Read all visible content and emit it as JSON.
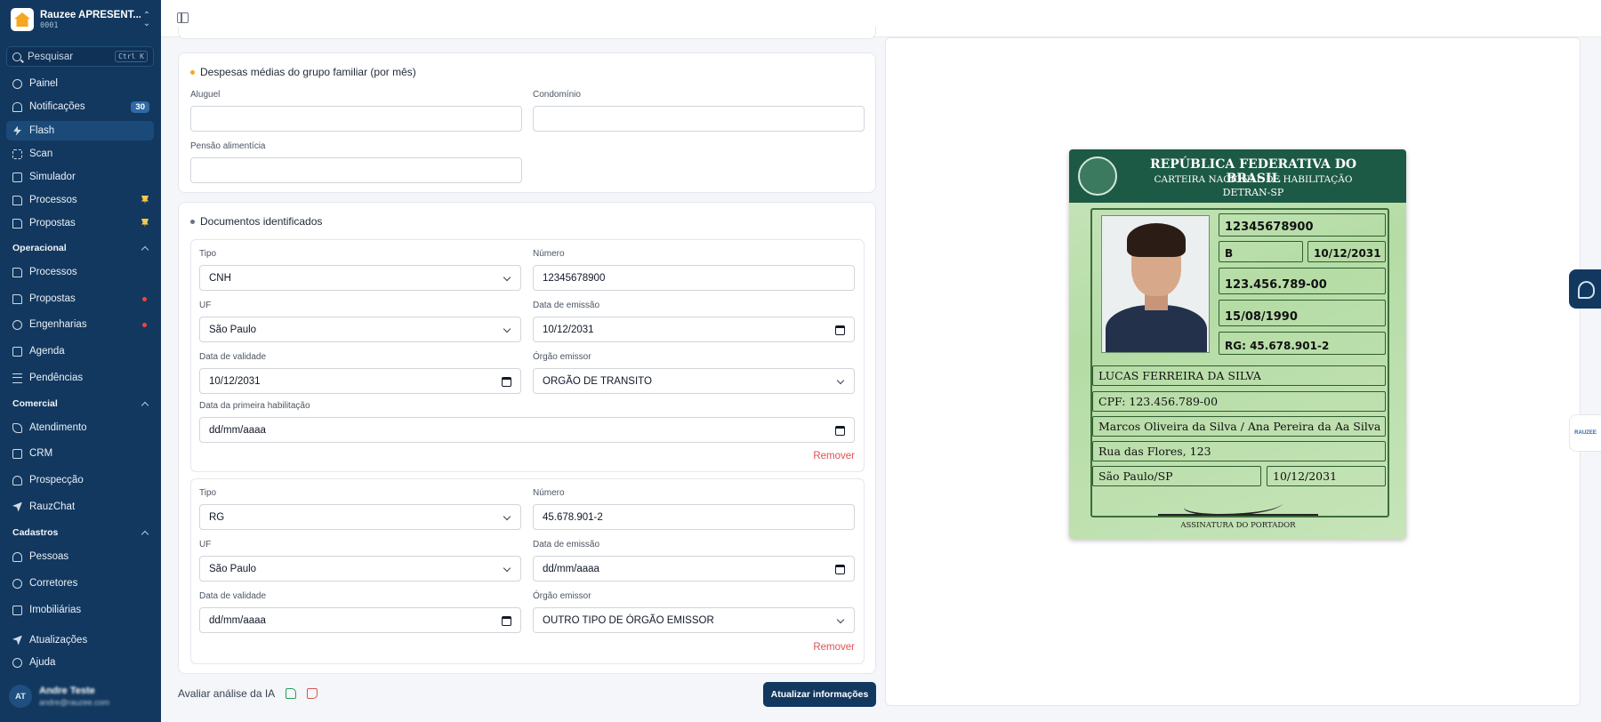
{
  "sidebar": {
    "org_name": "Rauzee APRESENT...",
    "org_code": "0001",
    "search_placeholder": "Pesquisar",
    "search_shortcut": "Ctrl K",
    "main_items": [
      {
        "label": "Painel",
        "icon": "gauge-icon"
      },
      {
        "label": "Notificações",
        "icon": "bell-icon",
        "badge": "30"
      },
      {
        "label": "Flash",
        "icon": "bolt-icon",
        "active": true
      },
      {
        "label": "Scan",
        "icon": "scan-icon"
      },
      {
        "label": "Simulador",
        "icon": "calculator-icon"
      },
      {
        "label": "Processos",
        "icon": "document-icon",
        "pinned": true
      },
      {
        "label": "Propostas",
        "icon": "document-icon",
        "pinned": true
      }
    ],
    "sections": [
      {
        "label": "Operacional",
        "items": [
          {
            "label": "Processos",
            "icon": "document-icon"
          },
          {
            "label": "Propostas",
            "icon": "document-icon",
            "dot": true
          },
          {
            "label": "Engenharias",
            "icon": "search-icon",
            "dot": true
          },
          {
            "label": "Agenda",
            "icon": "calendar-icon"
          },
          {
            "label": "Pendências",
            "icon": "list-check-icon"
          }
        ]
      },
      {
        "label": "Comercial",
        "items": [
          {
            "label": "Atendimento",
            "icon": "phone-icon"
          },
          {
            "label": "CRM",
            "icon": "building-icon"
          },
          {
            "label": "Prospecção",
            "icon": "user-plus-icon"
          },
          {
            "label": "RauzChat",
            "icon": "send-icon"
          }
        ]
      },
      {
        "label": "Cadastros",
        "items": [
          {
            "label": "Pessoas",
            "icon": "users-icon"
          },
          {
            "label": "Corretores",
            "icon": "at-icon"
          },
          {
            "label": "Imobiliárias",
            "icon": "store-icon"
          }
        ]
      }
    ],
    "footer_items": [
      {
        "label": "Atualizações",
        "icon": "rocket-icon"
      },
      {
        "label": "Ajuda",
        "icon": "help-icon"
      }
    ],
    "user": {
      "initials": "AT",
      "name": "Andre Teste",
      "email": "andre@rauzee.com"
    }
  },
  "expenses": {
    "title": "Despesas médias do grupo familiar (por mês)",
    "accent": "#f5a623",
    "fields": {
      "aluguel": {
        "label": "Aluguel",
        "value": ""
      },
      "condominio": {
        "label": "Condomínio",
        "value": ""
      },
      "pensao": {
        "label": "Pensão alimentícia",
        "value": ""
      }
    }
  },
  "documents": {
    "title": "Documentos identificados",
    "remove_label": "Remover",
    "items": [
      {
        "tipo": {
          "label": "Tipo",
          "value": "CNH"
        },
        "numero": {
          "label": "Número",
          "value": "12345678900"
        },
        "uf": {
          "label": "UF",
          "value": "São Paulo"
        },
        "emissao": {
          "label": "Data de emissão",
          "value": "10/12/2031"
        },
        "validade": {
          "label": "Data de validade",
          "value": "10/12/2031"
        },
        "orgao": {
          "label": "Órgão emissor",
          "value": "ORGÃO DE TRANSITO"
        },
        "primeira": {
          "label": "Data da primeira habilitação",
          "value": "dd/mm/aaaa"
        }
      },
      {
        "tipo": {
          "label": "Tipo",
          "value": "RG"
        },
        "numero": {
          "label": "Número",
          "value": "45.678.901-2"
        },
        "uf": {
          "label": "UF",
          "value": "São Paulo"
        },
        "emissao": {
          "label": "Data de emissão",
          "value": "dd/mm/aaaa"
        },
        "validade": {
          "label": "Data de validade",
          "value": "dd/mm/aaaa"
        },
        "orgao": {
          "label": "Órgão emissor",
          "value": "OUTRO TIPO DE ÓRGÃO EMISSOR"
        }
      }
    ]
  },
  "footer": {
    "rate_label": "Avaliar análise da IA",
    "update_button": "Atualizar informações"
  },
  "cnh_preview": {
    "header_line1": "REPÚBLICA FEDERATIVA DO BRASIL",
    "header_line2": "CARTEIRA NACIONAL DE HABILITAÇÃO",
    "header_line3": "DETRAN-SP",
    "registro": "12345678900",
    "categoria": "B",
    "validade": "10/12/2031",
    "cpf_box": "123.456.789-00",
    "nascimento": "15/08/1990",
    "rg": "RG: 45.678.901-2",
    "nome": "LUCAS FERREIRA DA SILVA",
    "cpf_line": "CPF: 123.456.789-00",
    "filiacao": "Marcos Oliveira da Silva / Ana Pereira da Aa Silva",
    "endereco": "Rua das Flores, 123",
    "cidade": "São Paulo/SP",
    "data_emissao": "10/12/2031",
    "assinatura_label": "ASSINATURA DO PORTADOR"
  },
  "side_widget_label": "RAUZEE"
}
